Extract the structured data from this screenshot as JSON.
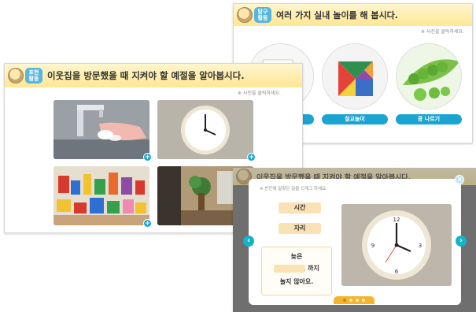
{
  "slide_inquiry": {
    "badge": "탐구\n활동",
    "title": "여러 가지 실내 놀이를 해 봅시다.",
    "hint": "※ 사진을 클릭하세요.",
    "items": [
      {
        "label": "기",
        "icon": "paper-picture"
      },
      {
        "label": "칠교놀이",
        "icon": "tangram-picture"
      },
      {
        "label": "콩 나르기",
        "icon": "peas-picture"
      }
    ]
  },
  "slide_expression": {
    "badge": "표현\n활동",
    "title": "이웃집을 방문했을 때 지켜야 할 예절을 알아봅시다.",
    "hint": "※ 사진을 클릭하세요.",
    "photos": [
      {
        "icon": "hand-washing-photo"
      },
      {
        "icon": "wall-clock-photo"
      },
      {
        "icon": "toys-photo"
      },
      {
        "icon": "living-room-photo"
      }
    ]
  },
  "slide_quiz": {
    "header_title": "이웃집을 방문했을 때 지켜야 할 예절을 알아봅시다.",
    "instruction": "※ 빈칸에 알맞은 말을 드래그 하세요.",
    "words": [
      "시간",
      "자리"
    ],
    "sentence": {
      "line1": "늦은",
      "line2_suffix": "까지",
      "line3": "놀지 않아요."
    },
    "photo_icon": "wall-clock-photo",
    "pagination": {
      "total": 4,
      "current": 1
    }
  },
  "colors": {
    "accent": "#1aa4d2",
    "title_bar": "#ffe793",
    "blank": "#fbe2b5",
    "overlay": "#6f6f6f"
  }
}
